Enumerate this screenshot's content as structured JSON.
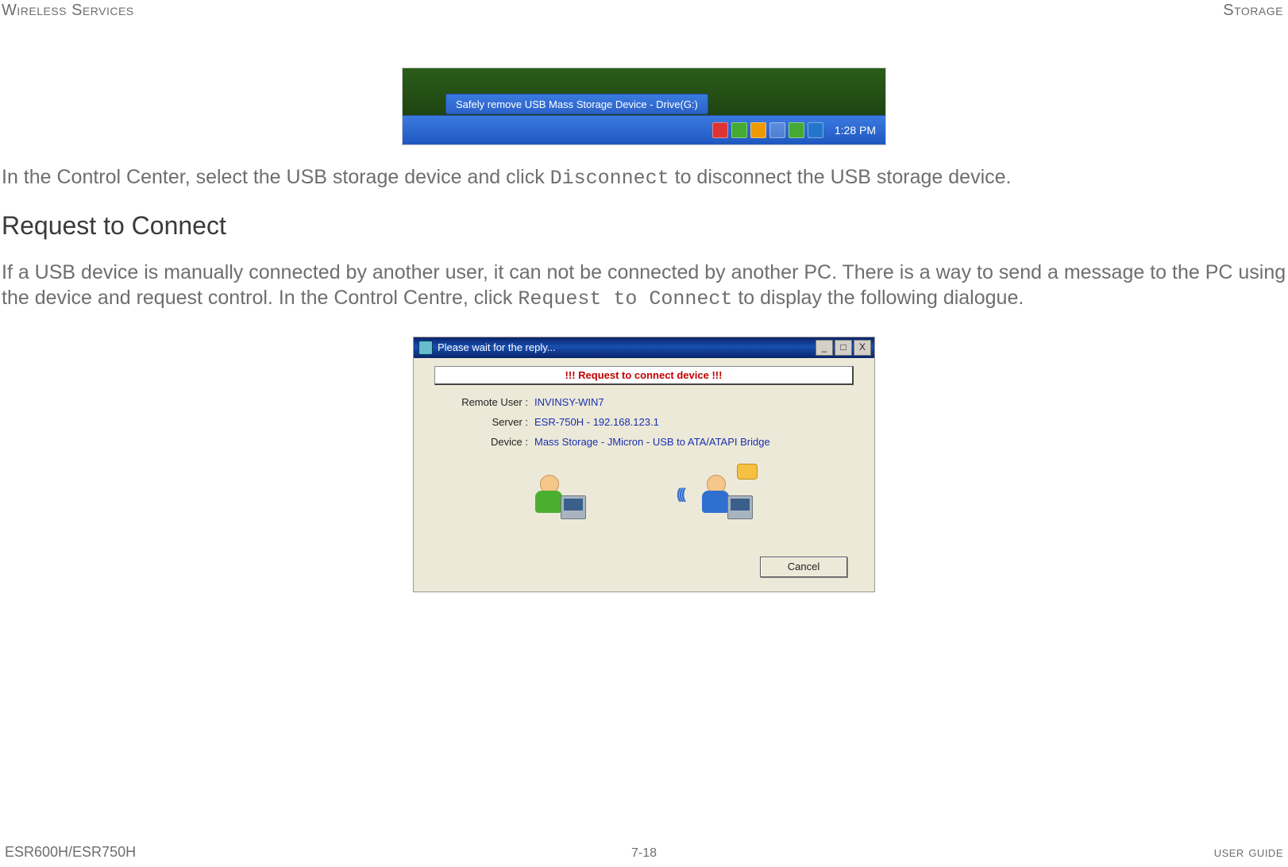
{
  "header": {
    "left": "Wireless Services",
    "right": "Storage"
  },
  "fig1": {
    "balloon_text": "Safely remove USB Mass Storage Device - Drive(G:)",
    "clock": "1:28 PM"
  },
  "para1": {
    "pre": "In the Control Center, select the USB storage device and click ",
    "code": "Disconnect",
    "post": " to disconnect the USB storage device."
  },
  "section_title": "Request to Connect",
  "para2": {
    "pre": "If a USB device is manually connected by another user, it can not be connected by another PC. There is a way to send a message to the PC using the device and request control. In the Control Centre, click ",
    "code": "Request to Connect",
    "post": " to display the following dialogue."
  },
  "fig2": {
    "title": "Please wait for the reply...",
    "banner": "!!! Request to connect device !!!",
    "rows": {
      "remote_user_label": "Remote User :",
      "remote_user_value": "INVINSY-WIN7",
      "server_label": "Server :",
      "server_value": "ESR-750H - 192.168.123.1",
      "device_label": "Device :",
      "device_value": "Mass Storage - JMicron - USB to ATA/ATAPI Bridge"
    },
    "cancel_label": "Cancel",
    "win_min": "_",
    "win_max": "□",
    "win_close": "X"
  },
  "footer": {
    "left": "ESR600H/ESR750H",
    "center": "7-18",
    "right": "user guide"
  }
}
